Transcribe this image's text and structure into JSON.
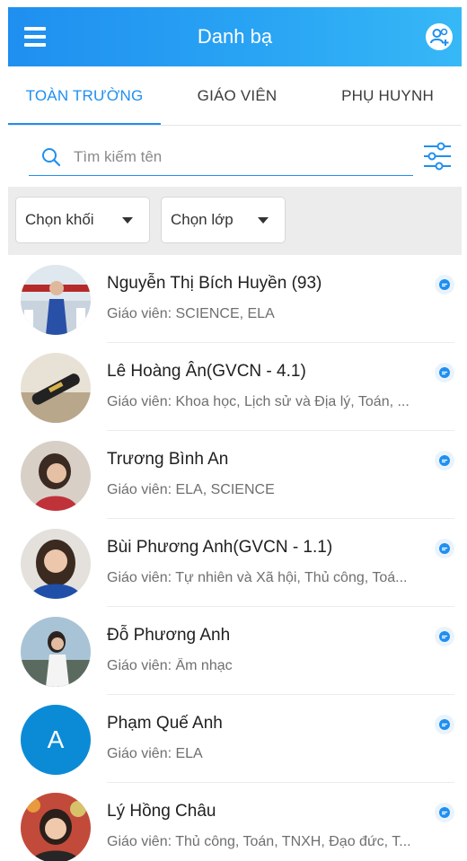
{
  "header": {
    "title": "Danh bạ"
  },
  "tabs": [
    {
      "label": "TOÀN TRƯỜNG",
      "active": true
    },
    {
      "label": "GIÁO VIÊN",
      "active": false
    },
    {
      "label": "PHỤ HUYNH",
      "active": false
    }
  ],
  "search": {
    "placeholder": "Tìm kiếm tên",
    "value": ""
  },
  "filters": {
    "grade_label": "Chọn khối",
    "class_label": "Chọn lớp"
  },
  "colors": {
    "accent": "#1f8ff0",
    "avatar_letter_bg": "#0b8bd6"
  },
  "contacts": [
    {
      "name": "Nguyễn Thị Bích Huyền (93)",
      "desc": "Giáo viên: SCIENCE, ELA",
      "avatar": "photo"
    },
    {
      "name": "Lê Hoàng Ân(GVCN - 4.1)",
      "desc": "Giáo viên: Khoa học, Lịch sử và Địa lý, Toán, ...",
      "avatar": "photo"
    },
    {
      "name": "Trương Bình An",
      "desc": "Giáo viên: ELA, SCIENCE",
      "avatar": "photo"
    },
    {
      "name": "Bùi  Phương Anh(GVCN - 1.1)",
      "desc": "Giáo viên: Tự nhiên và Xã hội, Thủ công, Toá...",
      "avatar": "photo"
    },
    {
      "name": "Đỗ Phương Anh",
      "desc": "Giáo viên: Âm nhạc",
      "avatar": "photo"
    },
    {
      "name": "Phạm Quế Anh",
      "desc": "Giáo viên: ELA",
      "avatar": "letter",
      "letter": "A"
    },
    {
      "name": "Lý Hồng Châu",
      "desc": "Giáo viên: Thủ công, Toán, TNXH, Đạo đức, T...",
      "avatar": "photo"
    }
  ]
}
